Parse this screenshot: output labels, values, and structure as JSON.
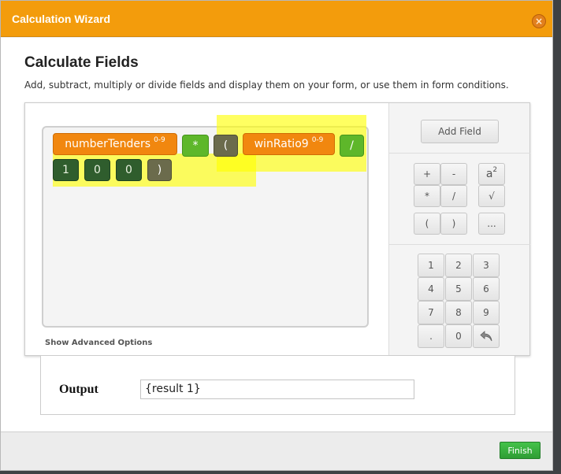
{
  "dialog": {
    "title": "Calculation Wizard",
    "close_symbol": "×"
  },
  "header": {
    "heading": "Calculate Fields",
    "subtitle": "Add, subtract, multiply or divide fields and display them on your form, or use them in form conditions."
  },
  "expression": {
    "tokens": [
      {
        "text": "numberTenders",
        "sup": "0-9"
      },
      {
        "text": "*"
      },
      {
        "text": "("
      },
      {
        "text": "winRatio9",
        "sup": "0-9"
      },
      {
        "text": "/"
      },
      {
        "text": "1"
      },
      {
        "text": "0"
      },
      {
        "text": "0"
      },
      {
        "text": ")"
      }
    ]
  },
  "advanced_link": "Show Advanced Options",
  "toolbar": {
    "add_field": "Add Field",
    "ops": [
      "+",
      "-",
      "a",
      "*",
      "/",
      "√",
      "(",
      ")",
      "..."
    ],
    "power_sup": "2",
    "keypad": [
      "1",
      "2",
      "3",
      "4",
      "5",
      "6",
      "7",
      "8",
      "9",
      ".",
      "0"
    ]
  },
  "output": {
    "label": "Output",
    "value": "{result 1}"
  },
  "footer": {
    "finish": "Finish"
  },
  "colors": {
    "accent": "#f39c0c",
    "field_token": "#f1870f",
    "operator_token": "#5eb72a",
    "paren_token": "#6b6b4c",
    "number_token": "#2f5d2d",
    "finish": "#36a93c",
    "highlight": "#ffff00"
  }
}
